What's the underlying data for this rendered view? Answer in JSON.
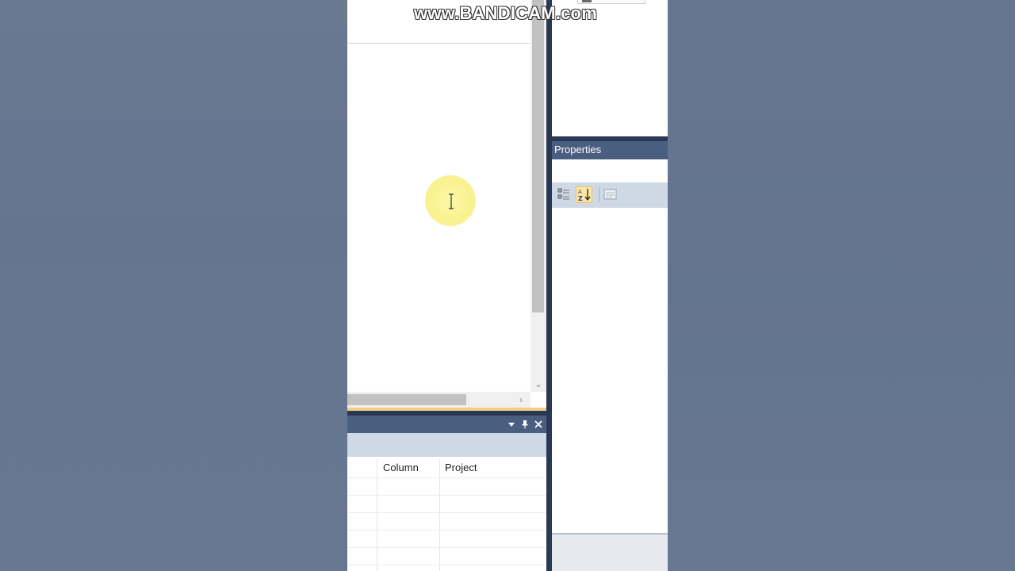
{
  "watermark": {
    "text": "www.BANDICAM.com"
  },
  "error_list": {
    "columns": [
      "Column",
      "Project"
    ]
  },
  "properties": {
    "title": "Properties",
    "toolbar": [
      {
        "name": "categorized-icon"
      },
      {
        "name": "alphabetical-sort-icon",
        "active": true
      },
      {
        "name": "property-pages-icon"
      }
    ]
  },
  "colors": {
    "backdrop": "#66758f",
    "panel_header": "#4a5e80",
    "toolbar": "#cfd8e5",
    "editor_accent": "#f5cc84",
    "cursor_highlight": "#faf28f"
  }
}
